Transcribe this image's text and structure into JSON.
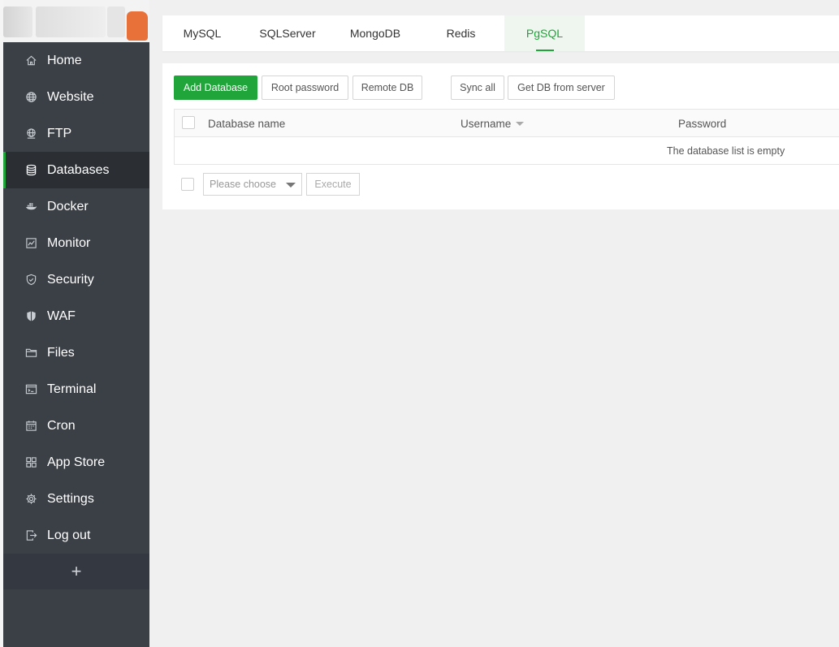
{
  "sidebar": {
    "items": [
      {
        "label": "Home",
        "icon": "home-icon",
        "active": false
      },
      {
        "label": "Website",
        "icon": "globe-icon",
        "active": false
      },
      {
        "label": "FTP",
        "icon": "ftp-globe-icon",
        "active": false
      },
      {
        "label": "Databases",
        "icon": "database-icon",
        "active": true
      },
      {
        "label": "Docker",
        "icon": "docker-icon",
        "active": false
      },
      {
        "label": "Monitor",
        "icon": "monitor-icon",
        "active": false
      },
      {
        "label": "Security",
        "icon": "shield-icon",
        "active": false
      },
      {
        "label": "WAF",
        "icon": "waf-shield-icon",
        "active": false
      },
      {
        "label": "Files",
        "icon": "folder-icon",
        "active": false
      },
      {
        "label": "Terminal",
        "icon": "terminal-icon",
        "active": false
      },
      {
        "label": "Cron",
        "icon": "calendar-icon",
        "active": false
      },
      {
        "label": "App Store",
        "icon": "grid-icon",
        "active": false
      },
      {
        "label": "Settings",
        "icon": "gear-icon",
        "active": false
      },
      {
        "label": "Log out",
        "icon": "logout-icon",
        "active": false
      }
    ],
    "add_label": "+"
  },
  "tabs": [
    {
      "label": "MySQL",
      "active": false
    },
    {
      "label": "SQLServer",
      "active": false
    },
    {
      "label": "MongoDB",
      "active": false
    },
    {
      "label": "Redis",
      "active": false
    },
    {
      "label": "PgSQL",
      "active": true
    }
  ],
  "toolbar": {
    "add_database": "Add Database",
    "root_password": "Root password",
    "remote_db": "Remote DB",
    "sync_all": "Sync all",
    "get_db_from_server": "Get DB from server"
  },
  "table": {
    "columns": {
      "database_name": "Database name",
      "username": "Username",
      "password": "Password"
    },
    "empty_message": "The database list is empty"
  },
  "bulk": {
    "select_placeholder": "Please choose",
    "execute": "Execute"
  },
  "colors": {
    "accent": "#20a53a",
    "sidebar_bg": "#3b4047",
    "sidebar_active_bg": "#2b2f34",
    "logo_orange": "#e8713a"
  }
}
